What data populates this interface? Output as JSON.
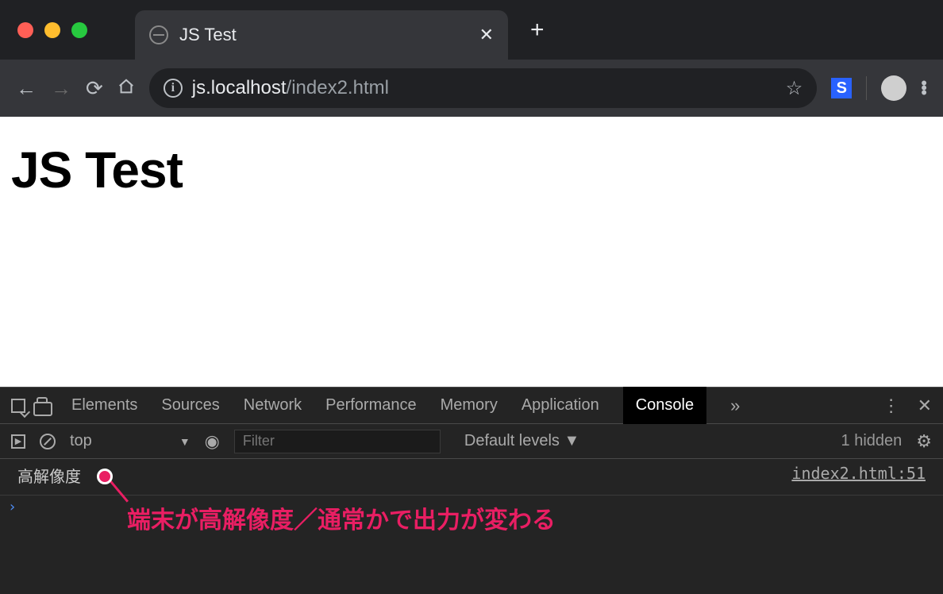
{
  "browser": {
    "tab_title": "JS Test",
    "url_host": "js.localhost",
    "url_path": "/index2.html",
    "extension_letter": "S"
  },
  "page": {
    "heading": "JS Test"
  },
  "devtools": {
    "tabs": [
      "Elements",
      "Sources",
      "Network",
      "Performance",
      "Memory",
      "Application",
      "Console"
    ],
    "active_tab": "Console",
    "context": "top",
    "filter_placeholder": "Filter",
    "levels_label": "Default levels",
    "hidden_label": "1 hidden",
    "log": {
      "message": "高解像度",
      "source": "index2.html:51"
    }
  },
  "annotation": {
    "text": "端末が高解像度／通常かで出力が変わる"
  }
}
